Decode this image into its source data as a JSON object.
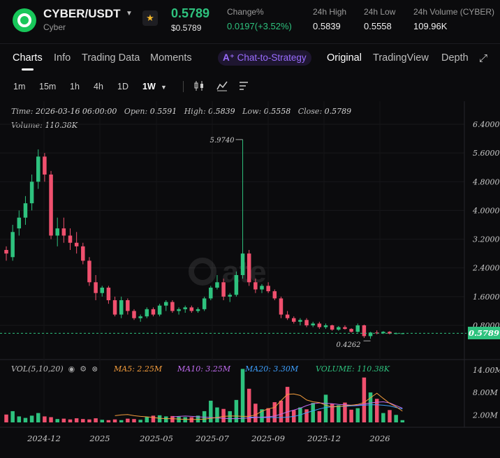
{
  "header": {
    "pair": "CYBER/USDT",
    "pair_sub": "Cyber",
    "price": "0.5789",
    "price_usd": "$0.5789",
    "stats": [
      {
        "label": "Change%",
        "value": "0.0197(+3.52%)"
      },
      {
        "label": "24h High",
        "value": "0.5839"
      },
      {
        "label": "24h Low",
        "value": "0.5558"
      },
      {
        "label": "24h Volume (CYBER)",
        "value": "109.96K"
      }
    ],
    "colors": {
      "up": "#2ec27e",
      "down": "#f0506e",
      "accent": "#9a6cff"
    }
  },
  "tabs": [
    "Charts",
    "Info",
    "Trading Data",
    "Moments"
  ],
  "strategy_label": "Chat-to-Strategy",
  "views": [
    "Original",
    "TradingView",
    "Depth"
  ],
  "timeframes": [
    "1m",
    "15m",
    "1h",
    "4h",
    "1D",
    "1W"
  ],
  "icons": [
    "star-icon",
    "caret-down-icon",
    "expand-icon",
    "candle-type-icon",
    "indicator-icon",
    "drawing-tools-icon",
    "eye-icon",
    "settings-icon",
    "close-icon"
  ],
  "ohlc": {
    "time": "2026-03-16 06:00:00",
    "open": "0.5591",
    "high": "0.5839",
    "low": "0.5558",
    "close": "0.5789",
    "volume": "110.38K"
  },
  "chart_labels": {
    "time_label": "Time:",
    "open_label": "Open:",
    "high_label": "High:",
    "low_label": "Low:",
    "close_label": "Close:",
    "volume_label": "Volume:",
    "high_marker": "5.9740",
    "low_marker": "0.4262",
    "current_price": "0.5789"
  },
  "vol_legend": {
    "title": "VOL(5,10,20)",
    "ma5": "MA5: 2.25M",
    "ma10": "MA10: 3.25M",
    "ma20": "MA20: 3.30M",
    "volume": "VOLUME: 110.38K",
    "ma5_color": "#f39c3c",
    "ma10_color": "#c06cf0",
    "ma20_color": "#3ea0ff",
    "volume_color": "#2ec27e"
  },
  "chart_data": {
    "type": "candlestick",
    "price_axis_ticks": [
      "6.4000",
      "5.6000",
      "4.8000",
      "4.0000",
      "3.2000",
      "2.4000",
      "1.6000",
      "0.8000"
    ],
    "price_axis_values": [
      6.4,
      5.6,
      4.8,
      4.0,
      3.2,
      2.4,
      1.6,
      0.8
    ],
    "volume_axis_ticks": [
      "14.00M",
      "8.00M",
      "2.00M"
    ],
    "volume_axis_values": [
      14,
      8,
      2
    ],
    "x_ticks": [
      "2024-12",
      "2025",
      "2025-05",
      "2025-07",
      "2025-09",
      "2025-12",
      "2026"
    ],
    "candles": [
      [
        2.9,
        3.0,
        2.6,
        2.8
      ],
      [
        2.7,
        3.6,
        2.6,
        3.4
      ],
      [
        3.5,
        4.0,
        3.3,
        3.8
      ],
      [
        3.8,
        4.4,
        3.6,
        4.2
      ],
      [
        4.2,
        5.0,
        4.0,
        4.8
      ],
      [
        4.8,
        5.7,
        4.6,
        5.5
      ],
      [
        5.5,
        5.6,
        4.8,
        5.0
      ],
      [
        5.0,
        5.1,
        3.2,
        3.3
      ],
      [
        3.3,
        3.8,
        3.0,
        3.5
      ],
      [
        3.5,
        3.8,
        3.1,
        3.3
      ],
      [
        3.3,
        3.5,
        2.9,
        3.1
      ],
      [
        3.1,
        3.4,
        2.8,
        3.0
      ],
      [
        3.0,
        3.1,
        2.5,
        2.6
      ],
      [
        2.6,
        2.7,
        1.9,
        2.0
      ],
      [
        2.0,
        2.2,
        1.5,
        1.7
      ],
      [
        1.7,
        1.9,
        1.6,
        1.85
      ],
      [
        1.85,
        1.9,
        1.4,
        1.5
      ],
      [
        1.5,
        1.6,
        1.05,
        1.1
      ],
      [
        1.1,
        1.6,
        1.0,
        1.5
      ],
      [
        1.5,
        1.55,
        1.1,
        1.2
      ],
      [
        1.2,
        1.25,
        0.95,
        1.0
      ],
      [
        1.0,
        1.1,
        0.9,
        1.05
      ],
      [
        1.05,
        1.3,
        1.0,
        1.25
      ],
      [
        1.25,
        1.3,
        1.05,
        1.1
      ],
      [
        1.1,
        1.4,
        1.05,
        1.35
      ],
      [
        1.35,
        1.5,
        1.2,
        1.45
      ],
      [
        1.45,
        1.5,
        1.15,
        1.2
      ],
      [
        1.2,
        1.3,
        1.1,
        1.25
      ],
      [
        1.25,
        1.35,
        1.15,
        1.3
      ],
      [
        1.3,
        1.35,
        1.15,
        1.2
      ],
      [
        1.2,
        1.3,
        1.15,
        1.25
      ],
      [
        1.25,
        1.6,
        1.2,
        1.55
      ],
      [
        1.55,
        1.9,
        1.5,
        1.85
      ],
      [
        1.85,
        2.2,
        1.8,
        2.0
      ],
      [
        2.0,
        2.1,
        1.5,
        1.6
      ],
      [
        1.6,
        1.7,
        1.45,
        1.65
      ],
      [
        1.65,
        2.3,
        1.6,
        2.2
      ],
      [
        2.2,
        5.974,
        2.1,
        2.8
      ],
      [
        2.8,
        2.9,
        1.9,
        2.0
      ],
      [
        2.0,
        2.1,
        1.7,
        1.8
      ],
      [
        1.8,
        1.95,
        1.7,
        1.9
      ],
      [
        1.9,
        2.0,
        1.7,
        1.75
      ],
      [
        1.75,
        1.8,
        1.5,
        1.55
      ],
      [
        1.55,
        1.6,
        1.0,
        1.1
      ],
      [
        1.1,
        1.2,
        0.95,
        1.0
      ],
      [
        1.0,
        1.05,
        0.85,
        0.9
      ],
      [
        0.9,
        1.0,
        0.8,
        0.95
      ],
      [
        0.95,
        1.0,
        0.75,
        0.8
      ],
      [
        0.8,
        0.9,
        0.75,
        0.85
      ],
      [
        0.85,
        0.9,
        0.7,
        0.75
      ],
      [
        0.75,
        0.85,
        0.7,
        0.8
      ],
      [
        0.8,
        0.82,
        0.65,
        0.68
      ],
      [
        0.68,
        0.78,
        0.65,
        0.75
      ],
      [
        0.75,
        0.8,
        0.68,
        0.7
      ],
      [
        0.7,
        0.72,
        0.6,
        0.62
      ],
      [
        0.62,
        0.85,
        0.6,
        0.8
      ],
      [
        0.8,
        0.82,
        0.45,
        0.5
      ],
      [
        0.5,
        0.62,
        0.4262,
        0.6
      ],
      [
        0.6,
        0.66,
        0.55,
        0.58
      ],
      [
        0.58,
        0.64,
        0.56,
        0.62
      ],
      [
        0.62,
        0.64,
        0.55,
        0.57
      ],
      [
        0.57,
        0.6,
        0.55,
        0.58
      ],
      [
        0.5591,
        0.5839,
        0.5558,
        0.5789
      ]
    ],
    "volumes": [
      2.1,
      3.0,
      1.6,
      1.2,
      1.8,
      2.5,
      1.6,
      1.4,
      0.9,
      1.0,
      0.8,
      1.1,
      0.9,
      0.8,
      1.1,
      0.7,
      0.6,
      0.8,
      0.6,
      1.0,
      0.9,
      0.7,
      1.5,
      1.8,
      1.9,
      1.6,
      1.7,
      1.5,
      1.4,
      1.4,
      1.8,
      3.0,
      5.8,
      4.0,
      3.6,
      3.0,
      6.0,
      14.3,
      9.0,
      5.0,
      3.5,
      3.8,
      5.4,
      5.8,
      9.5,
      3.3,
      4.0,
      3.5,
      5.2,
      3.0,
      7.4,
      5.0,
      4.6,
      5.3,
      3.4,
      3.8,
      12.0,
      8.0,
      6.3,
      2.5,
      3.3,
      2.0,
      0.6
    ],
    "volume_ma": {
      "ma5": [
        1.8,
        2.0,
        2.1,
        1.8,
        1.6,
        1.5,
        1.3,
        1.1,
        1.0,
        1.0,
        0.9,
        0.8,
        0.8,
        0.8,
        0.9,
        1.1,
        1.3,
        1.6,
        1.7,
        1.7,
        1.6,
        1.6,
        2.0,
        3.0,
        3.6,
        4.0,
        5.8,
        7.5,
        7.6,
        7.2,
        6.0,
        5.5,
        5.3,
        4.6,
        4.1,
        4.3,
        4.4,
        4.6,
        4.8,
        5.3,
        6.6,
        7.8,
        6.4,
        5.1,
        4.2,
        3.0
      ],
      "ma10": [
        1.5,
        1.6,
        1.7,
        1.6,
        1.5,
        1.4,
        1.3,
        1.2,
        1.1,
        1.0,
        1.0,
        1.1,
        1.2,
        1.3,
        1.4,
        1.5,
        1.7,
        2.2,
        2.8,
        3.3,
        3.8,
        4.5,
        5.0,
        5.2,
        5.1,
        5.0,
        4.8,
        4.7,
        4.6,
        4.6,
        4.9,
        5.2,
        5.4,
        5.5,
        5.2,
        4.5,
        3.8
      ],
      "ma20": [
        1.4,
        1.4,
        1.3,
        1.3,
        1.3,
        1.3,
        1.4,
        1.6,
        2.0,
        2.6,
        3.1,
        3.6,
        4.0,
        4.2,
        4.3,
        4.3,
        4.4,
        4.5,
        4.6,
        4.7,
        4.7,
        4.6,
        4.4,
        4.0,
        3.6
      ]
    }
  }
}
